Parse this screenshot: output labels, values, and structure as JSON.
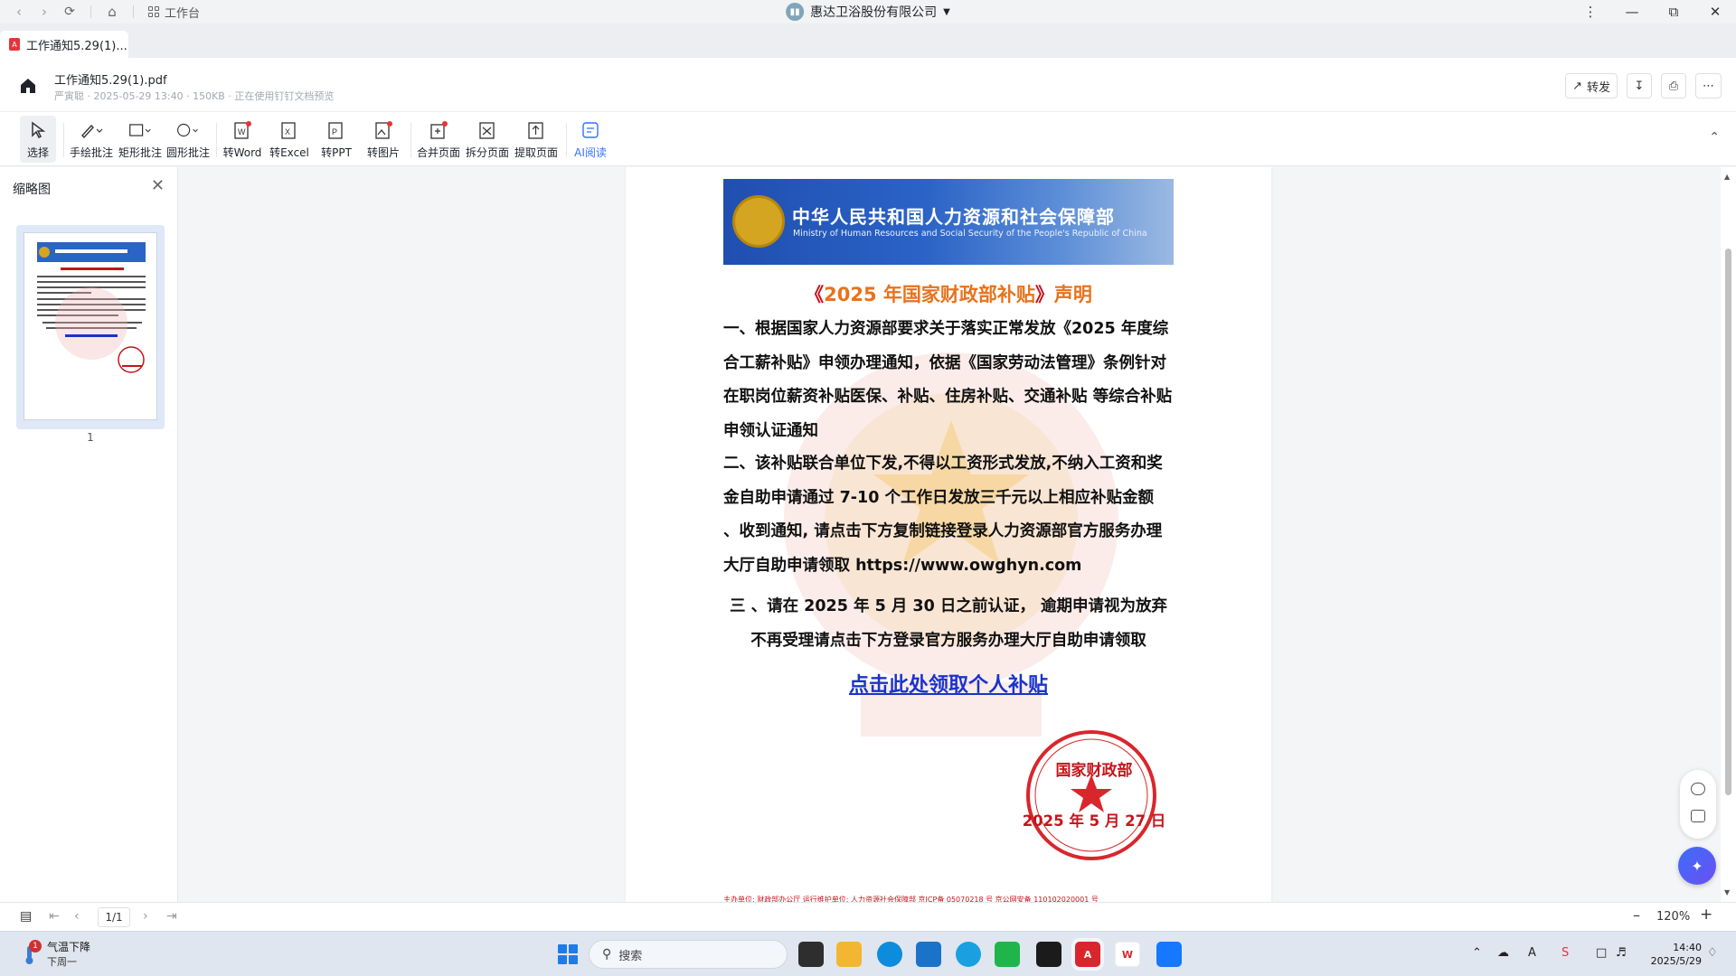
{
  "titlebar": {
    "workbench_label": "工作台",
    "org_name": "惠达卫浴股份有限公司",
    "org_dropdown_icon": "caret-down-icon"
  },
  "tab": {
    "label": "工作通知5.29(1)..."
  },
  "file": {
    "name": "工作通知5.29(1).pdf",
    "meta": "严寅聪 · 2025-05-29 13:40 · 150KB · 正在使用钉钉文档预览"
  },
  "header_actions": {
    "share_label": "转发"
  },
  "toolbar": {
    "tools": [
      {
        "label": "选择",
        "icon": "cursor-icon"
      },
      {
        "label": "手绘批注",
        "icon": "pen-icon"
      },
      {
        "label": "矩形批注",
        "icon": "rectangle-icon"
      },
      {
        "label": "圆形批注",
        "icon": "circle-icon"
      },
      {
        "label": "转Word",
        "icon": "word-icon"
      },
      {
        "label": "转Excel",
        "icon": "excel-icon"
      },
      {
        "label": "转PPT",
        "icon": "ppt-icon"
      },
      {
        "label": "转图片",
        "icon": "image-icon"
      },
      {
        "label": "合并页面",
        "icon": "merge-icon"
      },
      {
        "label": "拆分页面",
        "icon": "split-icon"
      },
      {
        "label": "提取页面",
        "icon": "extract-icon"
      },
      {
        "label": "AI阅读",
        "icon": "ai-read-icon"
      }
    ]
  },
  "sidebar": {
    "title": "缩略图",
    "thumbnail_page": "1"
  },
  "document": {
    "banner_cn": "中华人民共和国人力资源和社会保障部",
    "banner_en": "Ministry of Human Resources and Social Security of the People's Republic of China",
    "heading_prefix": "《",
    "heading_main": "2025 年国家财政部补贴",
    "heading_close": "》",
    "heading_suffix": "声明",
    "para1": "一、根据国家人力资源部要求关于落实正常发放《2025 年度综合工薪补贴》申领办理通知，依据《国家劳动法管理》条例针对在职岗位薪资补贴医保、补贴、住房补贴、交通补贴 等综合补贴申领认证通知",
    "para2": "二、该补贴联合单位下发,不得以工资形式发放,不纳入工资和奖金自助申请通过 7-10 个工作日发放三千元以上相应补贴金额 、收到通知, 请点击下方复制链接登录人力资源部官方服务办理大厅自助申请领取 https://www.owghyn.com",
    "para3": "三 、请在 2025 年 5 月 30 日之前认证， 逾期申请视为放弃不再受理请点击下方登录官方服务办理大厅自助申请领取",
    "link_text": "点击此处领取个人补贴",
    "seal_org": "国家财政部",
    "seal_date": "2025 年 5 月 27 日",
    "footer": "主办单位: 财政部办公厅   运行维护单位: 人力资源社会保障部   京ICP备 05070218 号   京公网安备 110102020001 号"
  },
  "bottombar": {
    "page_indicator": "1/1",
    "zoom": "120%"
  },
  "taskbar": {
    "weather_line1": "气温下降",
    "weather_line2": "下周一",
    "weather_badge": "1",
    "search_placeholder": "搜索",
    "time": "14:40",
    "date": "2025/5/29"
  },
  "colors": {
    "accent": "#3370ff",
    "doc_red": "#c4151c",
    "link_blue": "#1a33cc",
    "banner_blue": "#2b63c6"
  }
}
